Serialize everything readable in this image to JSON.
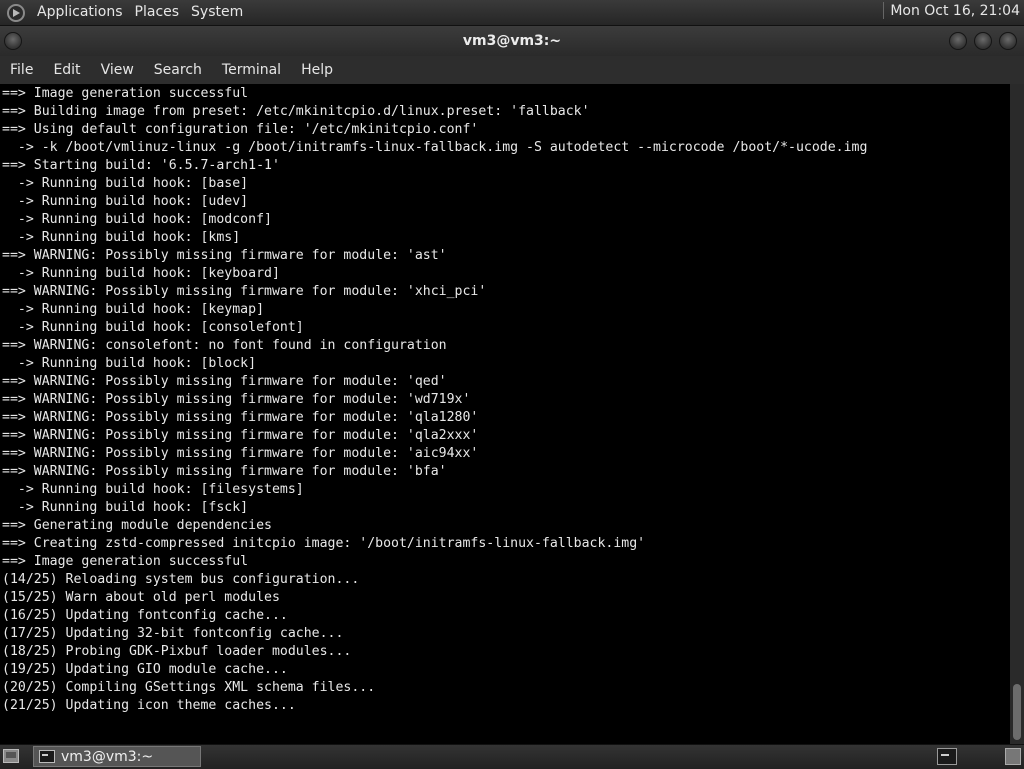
{
  "top_panel": {
    "menus": [
      "Applications",
      "Places",
      "System"
    ],
    "clock": "Mon Oct 16, 21:04",
    "logo_icon": "gnome-foot-menu-icon"
  },
  "window": {
    "title": "vm3@vm3:~",
    "menu": [
      "File",
      "Edit",
      "View",
      "Search",
      "Terminal",
      "Help"
    ]
  },
  "terminal": {
    "lines": [
      "==> Image generation successful",
      "==> Building image from preset: /etc/mkinitcpio.d/linux.preset: 'fallback'",
      "==> Using default configuration file: '/etc/mkinitcpio.conf'",
      "  -> -k /boot/vmlinuz-linux -g /boot/initramfs-linux-fallback.img -S autodetect --microcode /boot/*-ucode.img",
      "==> Starting build: '6.5.7-arch1-1'",
      "  -> Running build hook: [base]",
      "  -> Running build hook: [udev]",
      "  -> Running build hook: [modconf]",
      "  -> Running build hook: [kms]",
      "==> WARNING: Possibly missing firmware for module: 'ast'",
      "  -> Running build hook: [keyboard]",
      "==> WARNING: Possibly missing firmware for module: 'xhci_pci'",
      "  -> Running build hook: [keymap]",
      "  -> Running build hook: [consolefont]",
      "==> WARNING: consolefont: no font found in configuration",
      "  -> Running build hook: [block]",
      "==> WARNING: Possibly missing firmware for module: 'qed'",
      "==> WARNING: Possibly missing firmware for module: 'wd719x'",
      "==> WARNING: Possibly missing firmware for module: 'qla1280'",
      "==> WARNING: Possibly missing firmware for module: 'qla2xxx'",
      "==> WARNING: Possibly missing firmware for module: 'aic94xx'",
      "==> WARNING: Possibly missing firmware for module: 'bfa'",
      "  -> Running build hook: [filesystems]",
      "  -> Running build hook: [fsck]",
      "==> Generating module dependencies",
      "==> Creating zstd-compressed initcpio image: '/boot/initramfs-linux-fallback.img'",
      "==> Image generation successful",
      "(14/25) Reloading system bus configuration...",
      "(15/25) Warn about old perl modules",
      "(16/25) Updating fontconfig cache...",
      "(17/25) Updating 32-bit fontconfig cache...",
      "(18/25) Probing GDK-Pixbuf loader modules...",
      "(19/25) Updating GIO module cache...",
      "(20/25) Compiling GSettings XML schema files...",
      "(21/25) Updating icon theme caches..."
    ]
  },
  "taskbar": {
    "task_label": "vm3@vm3:~"
  }
}
